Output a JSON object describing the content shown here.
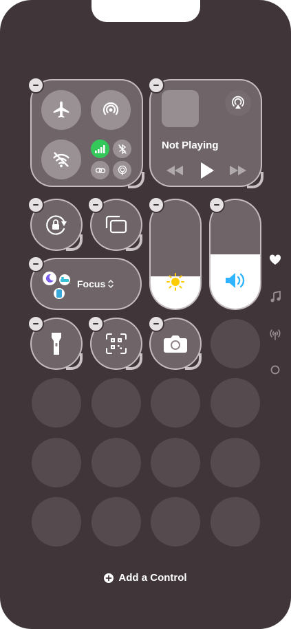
{
  "connectivity": {
    "airplane": "airplane-icon",
    "airdrop": "airdrop-icon",
    "wifi": "wifi-off-icon",
    "cellular": "cellular-icon",
    "bluetooth": "bluetooth-off-icon",
    "link": "chain-icon",
    "hotspot": "hotspot-icon"
  },
  "now_playing": {
    "title": "Not Playing",
    "airplay": "airplay-icon",
    "controls": [
      "rewind-icon",
      "play-icon",
      "fast-forward-icon"
    ]
  },
  "focus": {
    "label": "Focus"
  },
  "brightness": {
    "level": 0.3
  },
  "volume": {
    "level": 0.5
  },
  "side_pages": [
    "heart-icon",
    "music-note-icon",
    "antenna-icon",
    "circle-icon"
  ],
  "footer": {
    "add_control": "Add a Control"
  },
  "colors": {
    "background": "#403639",
    "cellular_green": "#34c759",
    "volume_blue": "#2fb4ff",
    "brightness_yellow": "#ffcc00"
  }
}
